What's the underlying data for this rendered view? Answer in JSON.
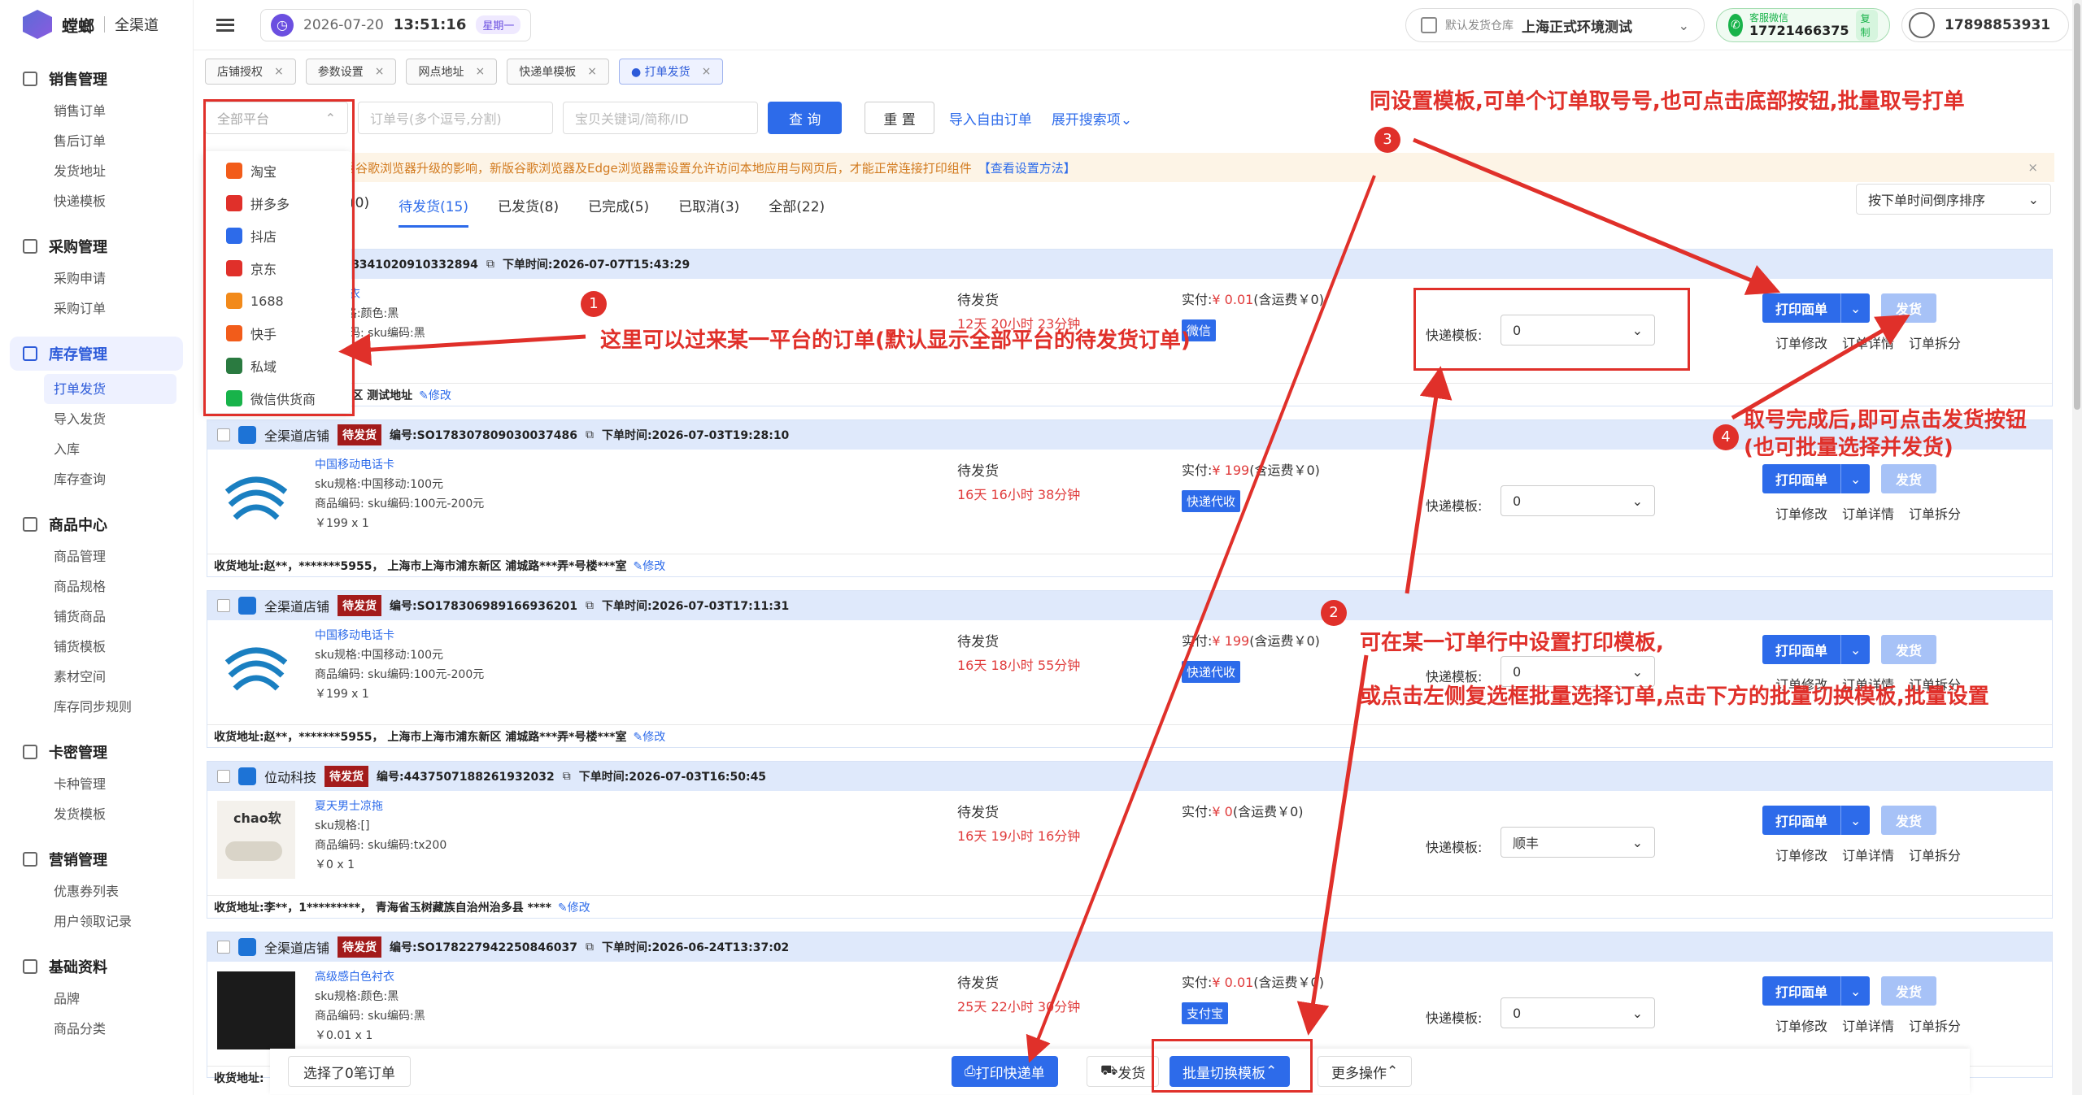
{
  "app": {
    "name": "螳螂",
    "subtitle": "全渠道"
  },
  "sidebar": {
    "groups": [
      {
        "title": "销售管理",
        "items": [
          "销售订单",
          "售后订单",
          "发货地址",
          "快递模板"
        ]
      },
      {
        "title": "采购管理",
        "items": [
          "采购申请",
          "采购订单"
        ]
      },
      {
        "title": "库存管理",
        "items": [
          "打单发货",
          "导入发货",
          "入库",
          "库存查询"
        ]
      },
      {
        "title": "商品中心",
        "items": [
          "商品管理",
          "商品规格",
          "铺货商品",
          "铺货模板",
          "素材空间",
          "库存同步规则"
        ]
      },
      {
        "title": "卡密管理",
        "items": [
          "卡种管理",
          "发货模板"
        ]
      },
      {
        "title": "营销管理",
        "items": [
          "优惠券列表",
          "用户领取记录"
        ]
      },
      {
        "title": "基础资料",
        "items": [
          "品牌",
          "商品分类"
        ]
      }
    ]
  },
  "topbar": {
    "date": "2026-07-20",
    "time": "13:51:16",
    "week": "星期一",
    "warehouse_label": "默认发货仓库",
    "warehouse": "上海正式环境测试",
    "wechat_label": "客服微信",
    "wechat_phone": "17721466375",
    "copy": "复制",
    "user": "17898853931"
  },
  "tabs": [
    {
      "label": "店铺授权"
    },
    {
      "label": "参数设置"
    },
    {
      "label": "网点地址"
    },
    {
      "label": "快递单模板"
    },
    {
      "label": "● 打单发货"
    }
  ],
  "filter": {
    "platform_placeholder": "全部平台",
    "order_placeholder": "订单号(多个逗号,分割)",
    "product_placeholder": "宝贝关键词/简称/ID",
    "query": "查 询",
    "reset": "重 置",
    "import": "导入自由订单",
    "expand": "展开搜索项"
  },
  "platforms": [
    "淘宝",
    "拼多多",
    "抖店",
    "京东",
    "1688",
    "快手",
    "私域",
    "微信供货商"
  ],
  "notice": {
    "text": "受谷歌浏览器升级的影响，新版谷歌浏览器及Edge浏览器需设置允许访问本地应用与网页后，才能正常连接打印组件",
    "link": "【查看设置方法】"
  },
  "status_tabs": [
    "(0)",
    "待发货(15)",
    "已发货(8)",
    "已完成(5)",
    "已取消(3)",
    "全部(22)"
  ],
  "sort": "按下单时间倒序排序",
  "common": {
    "status": "待发货",
    "tpl_label": "快递模板:",
    "print": "打印面单",
    "ship": "发货",
    "modify": "订单修改",
    "detail": "订单详情",
    "split": "订单拆分",
    "addr_label": "收货地址:",
    "edit": "修改",
    "badge": "待发货"
  },
  "orders": [
    {
      "shop": "",
      "no": "编号:SO178341020910332894",
      "time": "下单时间:2026-07-07T15:43:29",
      "goods": "白色衬衣",
      "sku": "sku规格:颜色:黑",
      "code": "商品编码:  sku编码:黑",
      "qty": "",
      "countdown": "12天 20小时 23分钟",
      "paid_pre": "实付:",
      "paid_amt": "¥ 0.01",
      "paid_post": "(含运费￥0)",
      "tag": "微信",
      "tpl": "0",
      "addr": "074，上海市上海市浦东新区 测试地址"
    },
    {
      "shop": "全渠道店铺",
      "no": "编号:SO178307809030037486",
      "time": "下单时间:2026-07-03T19:28:10",
      "goods": "中国移动电话卡",
      "sku": "sku规格:中国移动:100元",
      "code": "商品编码:  sku编码:100元-200元",
      "qty": "￥199 x 1",
      "countdown": "16天 16小时 38分钟",
      "paid_pre": "实付:",
      "paid_amt": "¥ 199",
      "paid_post": "(含运费￥0)",
      "tag": "快递代收",
      "tpl": "0",
      "addr": "赵**，*******5955，  上海市上海市浦东新区 浦城路***弄*号楼***室"
    },
    {
      "shop": "全渠道店铺",
      "no": "编号:SO178306989166936201",
      "time": "下单时间:2026-07-03T17:11:31",
      "goods": "中国移动电话卡",
      "sku": "sku规格:中国移动:100元",
      "code": "商品编码:  sku编码:100元-200元",
      "qty": "￥199 x 1",
      "countdown": "16天 18小时 55分钟",
      "paid_pre": "实付:",
      "paid_amt": "¥ 199",
      "paid_post": "(含运费￥0)",
      "tag": "快递代收",
      "tpl": "0",
      "addr": "赵**，*******5955，  上海市上海市浦东新区 浦城路***弄*号楼***室"
    },
    {
      "shop": "位动科技",
      "no": "编号:4437507188261932032",
      "time": "下单时间:2026-07-03T16:50:45",
      "goods": "夏天男士凉拖",
      "sku": "sku规格:[]",
      "code": "商品编码:  sku编码:tx200",
      "qty": "￥0 x 1",
      "countdown": "16天 19小时 16分钟",
      "paid_pre": "实付:",
      "paid_amt": "¥ 0",
      "paid_post": "(含运费￥0)",
      "tag": "",
      "tpl": "顺丰",
      "addr": "李**，1*********，  青海省玉树藏族自治州治多县 ****"
    },
    {
      "shop": "全渠道店铺",
      "no": "编号:SO178227942250846037",
      "time": "下单时间:2026-06-24T13:37:02",
      "goods": "高级感白色衬衣",
      "sku": "sku规格:颜色:黑",
      "code": "商品编码:  sku编码:黑",
      "qty": "￥0.01 x 1",
      "countdown": "25天 22小时 30分钟",
      "paid_pre": "实付:",
      "paid_amt": "¥ 0.01",
      "paid_post": "(含运费￥0)",
      "tag": "支付宝",
      "tpl": "0",
      "addr": ""
    }
  ],
  "bottom": {
    "selected": "选择了0笔订单",
    "print_express": "打印快递单",
    "ship": "发货",
    "batch_switch": "批量切换模板",
    "more": "更多操作"
  },
  "annotations": {
    "a1": "这里可以过来某一平台的订单(默认显示全部平台的待发货订单)",
    "a2_1": "可在某一订单行中设置打印模板,",
    "a2_2": "或点击左侧复选框批量选择订单,点击下方的批量切换模板,批量设置",
    "a3": "同设置模板,可单个订单取号号,也可点击底部按钮,批量取号打单",
    "a4_1": "取号完成后,即可点击发货按钮",
    "a4_2": "(也可批量选择并发货)",
    "n1": "1",
    "n2": "2",
    "n3": "3",
    "n4": "4"
  },
  "colors": {
    "primary": "#2d6bea",
    "annotation": "#e0302a",
    "badge": "#a31b1b"
  }
}
